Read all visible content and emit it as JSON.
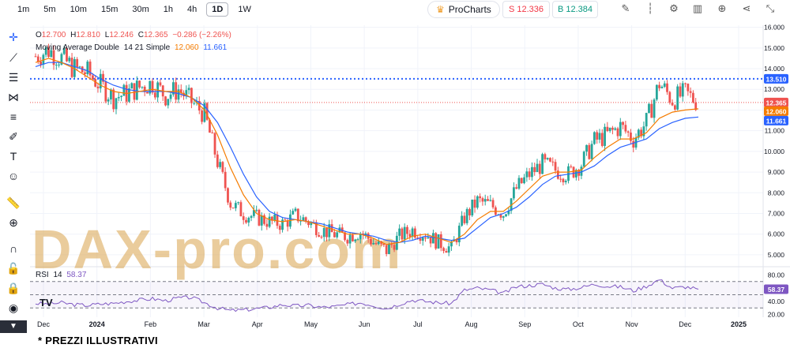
{
  "toolbar": {
    "timeframes": [
      "1m",
      "5m",
      "10m",
      "15m",
      "30m",
      "1h",
      "4h",
      "1D",
      "1W"
    ],
    "active_timeframe": "1D",
    "prochart_label": "ProCharts",
    "sell": "S 12.336",
    "buy": "B 12.384",
    "icons": [
      "pencil-icon",
      "candles-icon",
      "gear-icon",
      "layout-icon",
      "plus-circle-icon",
      "share-icon",
      "collapse-icon"
    ]
  },
  "left_tools": [
    "crosshair-icon",
    "line-icon",
    "lines-icon",
    "pattern-icon",
    "fib-icon",
    "brush-icon",
    "text-icon",
    "smile-icon",
    "ruler-icon",
    "zoom-icon",
    "magnet-icon",
    "lock-icon",
    "eye-icon",
    "trash-icon"
  ],
  "legend": {
    "ohlc_O_label": "O",
    "ohlc_O": "12.700",
    "ohlc_H_label": "H",
    "ohlc_H": "12.810",
    "ohlc_L_label": "L",
    "ohlc_L": "12.246",
    "ohlc_C_label": "C",
    "ohlc_C": "12.365",
    "change": "−0.286 (−2.26%)",
    "ma_label": "Moving Average Double",
    "ma_params": "14 21 Simple",
    "ma_fast": "12.060",
    "ma_slow": "11.661"
  },
  "rsi": {
    "label": "RSI",
    "period": "14",
    "value": "58.37"
  },
  "watermark": "DAX-pro.com",
  "tv_logo": "TV",
  "footnote": "* PREZZI ILLUSTRATIVI",
  "colors": {
    "up": "#26a69a",
    "down": "#ef5350",
    "ma_fast": "#f57c00",
    "ma_slow": "#2962ff",
    "rsi": "#7e57c2",
    "level_line": "#2962ff",
    "price_line": "#ef5350"
  },
  "chart_data": {
    "type": "candlestick",
    "y_axis_ticks": [
      "16.000",
      "15.000",
      "14.000",
      "13.000",
      "12.000",
      "11.000",
      "10.000",
      "9.000",
      "8.000",
      "7.000",
      "6.000",
      "5.000"
    ],
    "ylim": [
      4.5,
      16.1
    ],
    "x_axis_ticks": [
      "Dec",
      "2024",
      "Feb",
      "Mar",
      "Apr",
      "May",
      "Jun",
      "Jul",
      "Aug",
      "Sep",
      "Oct",
      "Nov",
      "Dec",
      "2025"
    ],
    "price_labels": {
      "level": "13.510",
      "last": "12.365",
      "ma_fast": "12.060",
      "ma_slow": "11.661"
    },
    "level_value": 13.51,
    "last_value": 12.365,
    "close_path": [
      [
        "Dec",
        14.6
      ],
      [
        "",
        14.9
      ],
      [
        "2024",
        14.5
      ],
      [
        "",
        14.0
      ],
      [
        "",
        13.8
      ],
      [
        "",
        13.2
      ],
      [
        "",
        12.6
      ],
      [
        "Feb",
        12.8
      ],
      [
        "",
        13.1
      ],
      [
        "",
        13.3
      ],
      [
        "",
        12.7
      ],
      [
        "",
        13.0
      ],
      [
        "Mar",
        12.4
      ],
      [
        "",
        11.8
      ],
      [
        "",
        9.5
      ],
      [
        "",
        7.5
      ],
      [
        "",
        7.0
      ],
      [
        "Apr",
        6.8
      ],
      [
        "",
        6.6
      ],
      [
        "",
        6.5
      ],
      [
        "May",
        6.9
      ],
      [
        "",
        6.6
      ],
      [
        "",
        6.2
      ],
      [
        "",
        6.0
      ],
      [
        "Jun",
        5.9
      ],
      [
        "",
        6.1
      ],
      [
        "",
        5.6
      ],
      [
        "Jul",
        5.2
      ],
      [
        "",
        5.9
      ],
      [
        "",
        6.2
      ],
      [
        "",
        6.0
      ],
      [
        "Aug",
        5.6
      ],
      [
        "",
        5.3
      ],
      [
        "",
        6.8
      ],
      [
        "",
        7.6
      ],
      [
        "Sep",
        7.4
      ],
      [
        "",
        7.0
      ],
      [
        "",
        8.2
      ],
      [
        "",
        8.9
      ],
      [
        "Oct",
        9.4
      ],
      [
        "",
        9.1
      ],
      [
        "",
        8.9
      ],
      [
        "",
        9.4
      ],
      [
        "Nov",
        10.5
      ],
      [
        "",
        10.8
      ],
      [
        "",
        11.2
      ],
      [
        "",
        10.6
      ],
      [
        "Dec",
        11.4
      ],
      [
        "",
        13.3
      ],
      [
        "",
        12.5
      ],
      [
        "",
        12.8
      ],
      [
        "",
        12.365
      ]
    ],
    "ma_fast_path": [
      14.3,
      14.5,
      14.3,
      14.0,
      13.6,
      13.2,
      12.9,
      12.8,
      12.9,
      13.0,
      12.9,
      12.9,
      12.6,
      12.0,
      10.8,
      9.2,
      7.9,
      7.0,
      6.7,
      6.6,
      6.7,
      6.6,
      6.4,
      6.2,
      6.0,
      6.0,
      5.8,
      5.5,
      5.6,
      5.9,
      6.0,
      5.8,
      5.6,
      6.0,
      6.7,
      7.1,
      7.1,
      7.6,
      8.2,
      8.8,
      9.0,
      9.0,
      9.1,
      9.7,
      10.2,
      10.6,
      10.6,
      10.9,
      11.6,
      11.9,
      12.0,
      12.06
    ],
    "ma_slow_path": [
      14.1,
      14.3,
      14.3,
      14.1,
      13.9,
      13.5,
      13.2,
      13.0,
      12.9,
      12.9,
      12.9,
      12.8,
      12.6,
      12.2,
      11.4,
      10.2,
      8.9,
      7.8,
      7.1,
      6.8,
      6.7,
      6.6,
      6.5,
      6.3,
      6.1,
      6.0,
      5.9,
      5.7,
      5.6,
      5.7,
      5.9,
      5.8,
      5.7,
      5.8,
      6.3,
      6.8,
      7.0,
      7.3,
      7.8,
      8.4,
      8.8,
      8.9,
      9.0,
      9.3,
      9.8,
      10.2,
      10.4,
      10.6,
      11.1,
      11.4,
      11.6,
      11.661
    ],
    "rsi_ylim": [
      16,
      90
    ],
    "rsi_ticks": [
      "80.00",
      "60.00",
      "40.00",
      "20.00"
    ],
    "rsi_levels": [
      70,
      30
    ],
    "rsi_path": [
      37,
      36,
      38,
      35,
      34,
      36,
      37,
      40,
      42,
      44,
      41,
      45,
      46,
      38,
      30,
      26,
      27,
      29,
      31,
      35,
      33,
      34,
      31,
      32,
      35,
      38,
      34,
      29,
      36,
      42,
      40,
      38,
      37,
      57,
      60,
      57,
      52,
      62,
      64,
      66,
      60,
      58,
      61,
      66,
      63,
      62,
      56,
      63,
      73,
      60,
      62,
      58.37
    ]
  }
}
